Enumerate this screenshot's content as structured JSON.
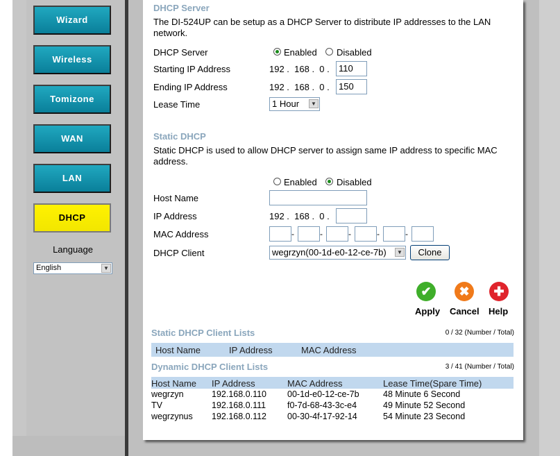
{
  "sidebar": {
    "nav": [
      {
        "label": "Wizard"
      },
      {
        "label": "Wireless"
      },
      {
        "label": "Tomizone"
      },
      {
        "label": "WAN"
      },
      {
        "label": "LAN"
      },
      {
        "label": "DHCP",
        "active": true
      }
    ],
    "language_label": "Language",
    "language_value": "English"
  },
  "dhcp_server": {
    "title": "DHCP Server",
    "description": "The DI-524UP can be setup as a DHCP Server to distribute IP addresses to the LAN network.",
    "server_label": "DHCP Server",
    "enabled_label": "Enabled",
    "disabled_label": "Disabled",
    "selected": "Enabled",
    "start_label": "Starting IP Address",
    "end_label": "Ending IP Address",
    "ip_prefix": "192 .  168 .  0 .",
    "start_value": "110",
    "end_value": "150",
    "lease_label": "Lease Time",
    "lease_value": "1 Hour"
  },
  "static_dhcp": {
    "title": "Static DHCP",
    "description": "Static DHCP is used to allow DHCP server to assign same IP address to specific MAC address.",
    "enabled_label": "Enabled",
    "disabled_label": "Disabled",
    "selected": "Disabled",
    "host_label": "Host Name",
    "host_value": "",
    "ip_label": "IP Address",
    "ip_prefix": "192 .  168 .  0 .",
    "ip_value": "",
    "mac_label": "MAC Address",
    "client_label": "DHCP Client",
    "client_value": "wegrzyn(00-1d-e0-12-ce-7b)",
    "clone_label": "Clone"
  },
  "actions": {
    "apply": "Apply",
    "cancel": "Cancel",
    "help": "Help",
    "apply_color": "#3fae2a",
    "cancel_color": "#f07a1a",
    "help_color": "#e0242c"
  },
  "static_list": {
    "title": "Static DHCP Client Lists",
    "count": "0 / 32 (Number / Total)",
    "headers": [
      "Host Name",
      "IP Address",
      "MAC Address"
    ]
  },
  "dynamic_list": {
    "title": "Dynamic DHCP Client Lists",
    "count": "3 / 41 (Number / Total)",
    "headers": [
      "Host Name",
      "IP Address",
      "MAC Address",
      "Lease Time(Spare Time)"
    ],
    "rows": [
      [
        "wegrzyn",
        "192.168.0.110",
        "00-1d-e0-12-ce-7b",
        "48 Minute 6 Second"
      ],
      [
        "TV",
        "192.168.0.111",
        "f0-7d-68-43-3c-e4",
        "49 Minute 52 Second"
      ],
      [
        "wegrzynus",
        "192.168.0.112",
        "00-30-4f-17-92-14",
        "54 Minute 23 Second"
      ]
    ]
  },
  "colors": {
    "nav_button": "#0a8fa8",
    "nav_active": "#fff200",
    "section_title": "#8aa6bc",
    "list_header": "#c1d8ee"
  }
}
